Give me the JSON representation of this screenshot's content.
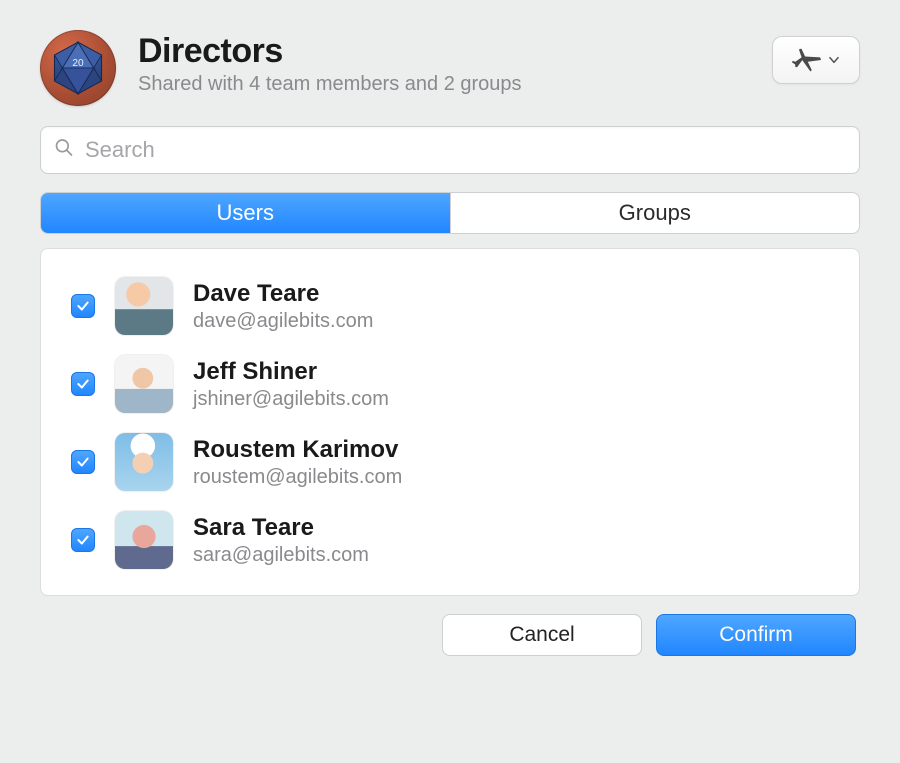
{
  "header": {
    "title": "Directors",
    "subtitle": "Shared with 4 team members and 2 groups",
    "icon_badge_text": "20"
  },
  "search": {
    "placeholder": "Search",
    "value": ""
  },
  "tabs": {
    "users": "Users",
    "groups": "Groups",
    "active": "users"
  },
  "users": [
    {
      "name": "Dave Teare",
      "email": "dave@agilebits.com",
      "checked": true
    },
    {
      "name": "Jeff Shiner",
      "email": "jshiner@agilebits.com",
      "checked": true
    },
    {
      "name": "Roustem Karimov",
      "email": "roustem@agilebits.com",
      "checked": true
    },
    {
      "name": "Sara Teare",
      "email": "sara@agilebits.com",
      "checked": true
    }
  ],
  "buttons": {
    "cancel": "Cancel",
    "confirm": "Confirm"
  }
}
